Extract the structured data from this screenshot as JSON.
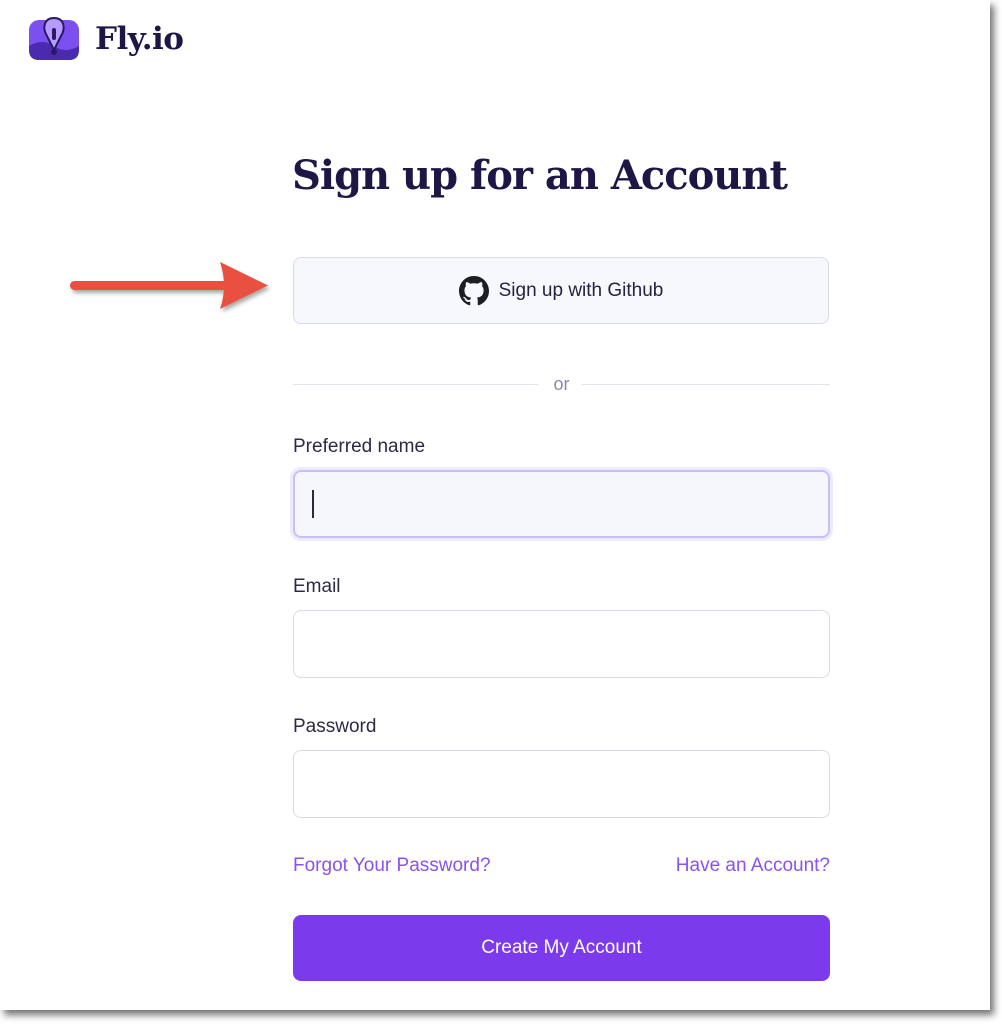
{
  "brand": {
    "name": "Fly.io"
  },
  "page": {
    "title": "Sign up for an Account"
  },
  "github_button": {
    "label": "Sign up with Github"
  },
  "divider": {
    "text": "or"
  },
  "form": {
    "preferred_name": {
      "label": "Preferred name",
      "value": ""
    },
    "email": {
      "label": "Email",
      "value": ""
    },
    "password": {
      "label": "Password",
      "value": ""
    }
  },
  "links": {
    "forgot_password": "Forgot Your Password?",
    "have_account": "Have an Account?"
  },
  "submit": {
    "label": "Create My Account"
  },
  "colors": {
    "primary": "#7c3aed",
    "link": "#8a52f0",
    "heading": "#1f1646",
    "annotation_arrow": "#e8513f"
  },
  "icons": [
    "fly-logo-icon",
    "github-icon",
    "annotation-arrow-icon"
  ]
}
